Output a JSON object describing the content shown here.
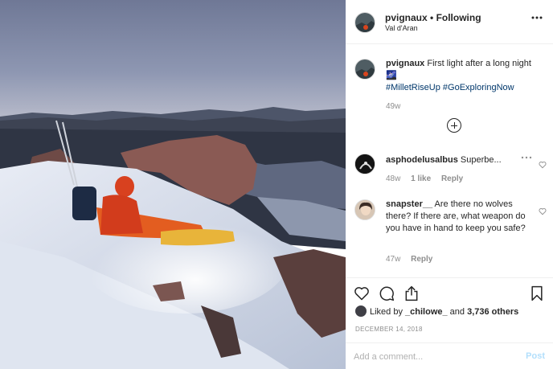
{
  "header": {
    "username": "pvignaux",
    "separator": " • ",
    "follow_status": "Following",
    "location": "Val d'Aran",
    "more_icon": "more-horizontal-icon"
  },
  "caption": {
    "username": "pvignaux",
    "text": " First light after a long night ",
    "emoji": "🌌",
    "hashtags": [
      "#MilletRiseUp",
      "#GoExploringNow"
    ],
    "time": "49w"
  },
  "comments": [
    {
      "username": "asphodelusalbus",
      "text": " Superbe...",
      "time": "48w",
      "likes": "1 like",
      "reply": "Reply"
    },
    {
      "username": "snapster__",
      "text": " Are there no wolves there? If there are, what weapon do you have in hand to keep you safe?",
      "time": "47w",
      "reply": "Reply"
    }
  ],
  "liked_by": {
    "prefix": "Liked by ",
    "user": "_chilowe_",
    "and": " and ",
    "count": "3,736 others"
  },
  "date": "DECEMBER 14, 2018",
  "add_comment": {
    "placeholder": "Add a comment...",
    "post_label": "Post"
  },
  "icons": {
    "like": "heart-icon",
    "comment": "comment-icon",
    "share": "share-icon",
    "save": "bookmark-icon",
    "load_more": "plus-circle-icon"
  }
}
